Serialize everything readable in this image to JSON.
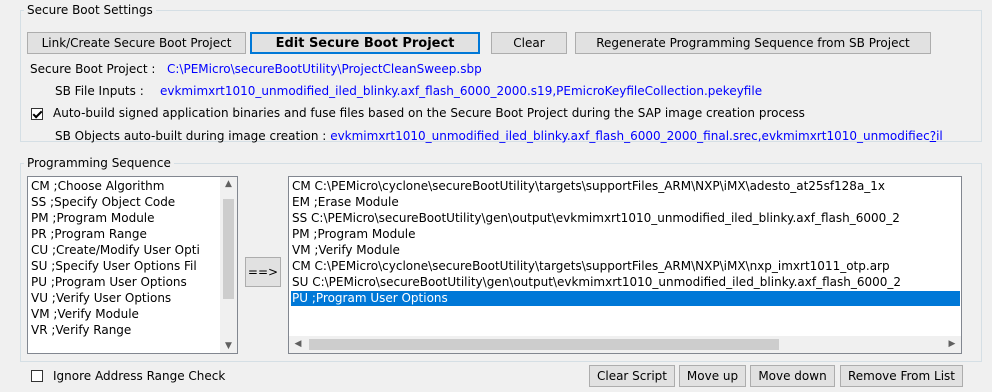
{
  "secure_boot": {
    "group_title": "Secure Boot Settings",
    "buttons": {
      "link_create": "Link/Create Secure Boot Project",
      "edit": "Edit Secure Boot Project",
      "clear": "Clear",
      "regenerate": "Regenerate Programming Sequence from SB Project"
    },
    "project_label": "Secure Boot Project :",
    "project_value": "C:\\PEMicro\\secureBootUtility\\ProjectCleanSweep.sbp",
    "inputs_label": "SB File Inputs :",
    "inputs_value": "evkmimxrt1010_unmodified_iled_blinky.axf_flash_6000_2000.s19,PEmicroKeyfileCollection.pekeyfile",
    "autobuild_checked": true,
    "autobuild_label": "Auto-build signed application binaries and fuse files based on the Secure Boot Project during the SAP image creation process",
    "objects_label": "SB Objects auto-built during image creation :",
    "objects_value": "evkmimxrt1010_unmodified_iled_blinky.axf_flash_6000_2000_final.srec,evkmimxrt1010_unmodifiec",
    "objects_more": "?",
    "objects_more_tail": "il"
  },
  "programming": {
    "group_title": "Programming Sequence",
    "commands": [
      "CM  ;Choose Algorithm",
      "SS  ;Specify Object Code",
      "PM  ;Program Module",
      "PR  ;Program Range",
      "CU  ;Create/Modify User Opti",
      "SU  ;Specify User Options Fil",
      "PU  ;Program User Options",
      "VU  ;Verify User Options",
      "VM  ;Verify Module",
      "VR  ;Verify Range"
    ],
    "add_button": "==>",
    "script_lines": [
      "CM  C:\\PEMicro\\cyclone\\secureBootUtility\\targets\\supportFiles_ARM\\NXP\\iMX\\adesto_at25sf128a_1x",
      "EM  ;Erase Module",
      "SS  C:\\PEMicro\\secureBootUtility\\gen\\output\\evkmimxrt1010_unmodified_iled_blinky.axf_flash_6000_2",
      "PM  ;Program Module",
      "VM  ;Verify Module",
      "CM  C:\\PEMicro\\cyclone\\secureBootUtility\\targets\\supportFiles_ARM\\NXP\\iMX\\nxp_imxrt1011_otp.arp",
      "SU  C:\\PEMicro\\secureBootUtility\\gen\\output\\evkmimxrt1010_unmodified_iled_blinky.axf_flash_6000_2",
      "PU  ;Program User Options"
    ],
    "selected_index": 7,
    "ignore_label": "Ignore Address Range Check",
    "ignore_checked": false,
    "buttons": {
      "clear_script": "Clear Script",
      "move_up": "Move up",
      "move_down": "Move down",
      "remove": "Remove From List"
    }
  }
}
